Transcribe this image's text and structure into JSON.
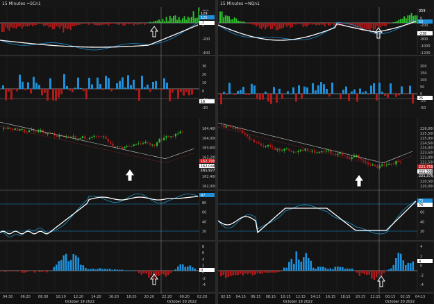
{
  "left": {
    "title": "15 Minutes =SCn1",
    "pane1_ticks": [
      "200",
      "0",
      "-200",
      "-400"
    ],
    "pane1_tags": {
      "top": "129",
      "mid": "125",
      "low": "-7"
    },
    "pane2_ticks": [
      "30",
      "20",
      "10",
      "0",
      "-10",
      "-20"
    ],
    "pane2_tag": "16",
    "pane3_ticks": [
      "164,400",
      "164,000",
      "163,600",
      "163,200",
      "162,800",
      "162,400",
      "162,000"
    ],
    "pane3_tags": {
      "a": "162,700",
      "b": "162,044",
      "c": "161,927"
    },
    "pane4_ticks": [
      "80",
      "60",
      "40",
      "20"
    ],
    "pane4_tag": "47",
    "pane5_ticks": [
      "8",
      "6",
      "4",
      "2",
      "0",
      "-2",
      "-4"
    ],
    "pane5_tag": "0",
    "time_ticks": [
      "04:30",
      "06:20",
      "08:30",
      "10:20",
      "12:20",
      "14:20",
      "16:20",
      "18:20",
      "20:20",
      "22:20",
      "00:20",
      "02:20"
    ],
    "date_left": "October 19 2022",
    "date_right": "October 20 2022"
  },
  "right": {
    "title": "15 Minutes =NQn1",
    "pane1_ticks": [
      "359",
      "0",
      "-200",
      "-600",
      "-800",
      "-1000",
      "-1200"
    ],
    "pane1_tags": {
      "top": "359",
      "mid": "52",
      "low": "-238"
    },
    "pane2_ticks": [
      "200",
      "150",
      "100",
      "50",
      "0",
      "-25",
      "-50"
    ],
    "pane2_tag": "25",
    "pane3_ticks": [
      "226,000",
      "225,500",
      "225,000",
      "224,500",
      "224,000",
      "223,500",
      "223,000",
      "222,500",
      "222,000",
      "221,500",
      "221,000",
      "220,500",
      "220,000"
    ],
    "pane3_tags": {
      "a": "221,750",
      "b": "221,500",
      "c": "221,375"
    },
    "pane4_ticks": [
      "80",
      "60",
      "40",
      "20"
    ],
    "pane4_tags": {
      "a": "73",
      "b": "76"
    },
    "pane5_ticks": [
      "4",
      "2",
      "0",
      "-2",
      "-4"
    ],
    "pane5_tag": "4",
    "time_ticks": [
      "02:15",
      "04:15",
      "06:15",
      "08:15",
      "10:15",
      "12:15",
      "14:15",
      "16:15",
      "18:15",
      "20:15",
      "22:15",
      "00:15",
      "02:15",
      "04:15"
    ],
    "date_left": "October 19 2022",
    "date_right": "October 20 2022"
  },
  "colors": {
    "up": "#2fbf2f",
    "down": "#b01a1a",
    "blue": "#1e8fd8",
    "cyan": "#2aa9e0",
    "white": "#ffffff"
  }
}
